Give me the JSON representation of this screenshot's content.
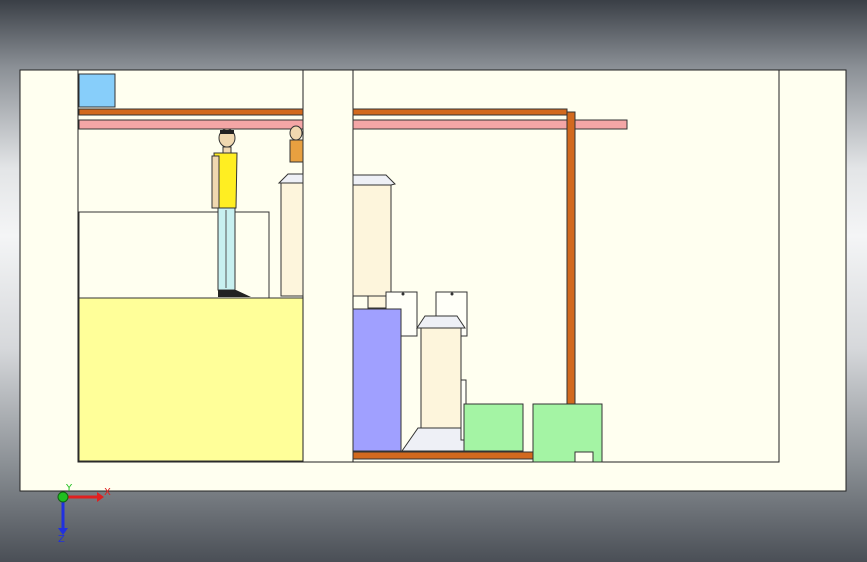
{
  "viewport": {
    "background_top": "#3a3f46",
    "background_mid": "#f4f5f6"
  },
  "colors": {
    "plate": "#fffff0",
    "outline": "#222222",
    "floor_slab": "#ffff99",
    "beam_orange": "#d2691e",
    "beam_pink": "#f4a6a6",
    "equipment_cream": "#fdf5dc",
    "equipment_cap": "#eef0f6",
    "blue_block": "#a0a0ff",
    "green_block": "#a4f4a4",
    "window_blue": "#87cefa",
    "shirt_yellow": "#ffee22",
    "pants_cyan": "#c8f0f0"
  },
  "triad": {
    "x_label": "X",
    "y_label": "Y",
    "z_label": "Z",
    "x_color": "#e02020",
    "y_color": "#20c020",
    "z_color": "#2030e0"
  }
}
